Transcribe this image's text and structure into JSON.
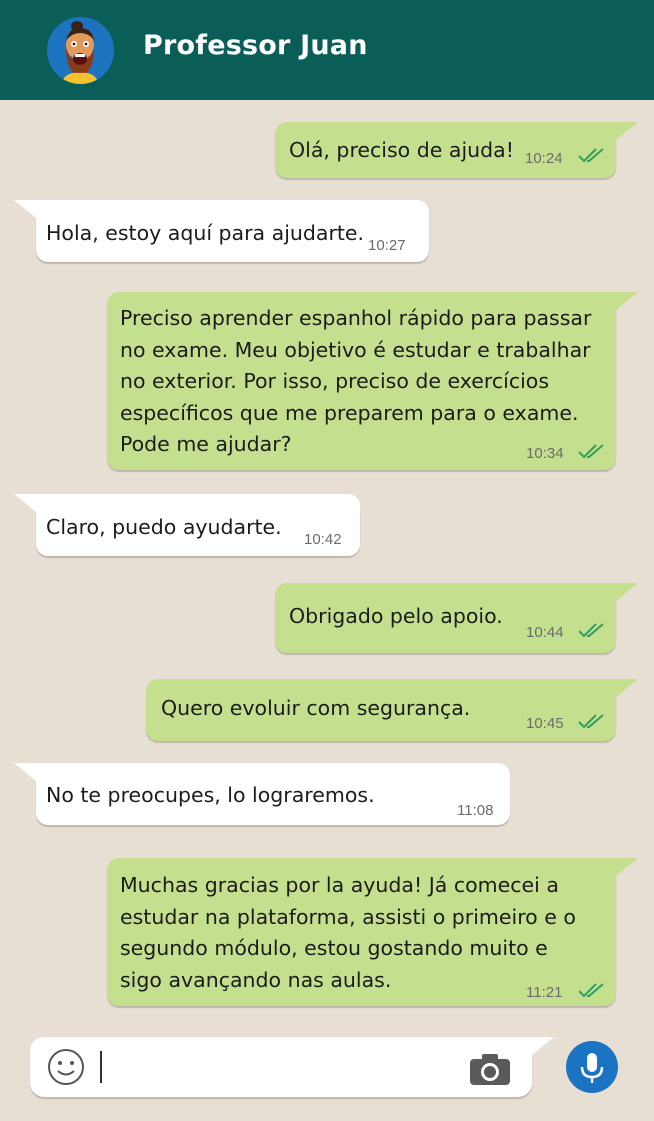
{
  "header": {
    "contact_name": "Professor Juan",
    "avatar_icon": "bearded-cartoon-man-avatar",
    "bar_color": "#0b5e58"
  },
  "colors": {
    "background": "#e8dfd4",
    "outgoing_bubble": "#c4e08f",
    "incoming_bubble": "#ffffff",
    "read_check": "#2f9e5e",
    "mic_button": "#1b73c4"
  },
  "messages": [
    {
      "direction": "out",
      "text": "Olá, preciso de ajuda!",
      "time": "10:24",
      "status": "read"
    },
    {
      "direction": "in",
      "text": "Hola, estoy aquí para ajudarte.",
      "time": "10:27"
    },
    {
      "direction": "out",
      "text": "Preciso aprender espanhol rápido para passar\nno exame. Meu objetivo é estudar e trabalhar\nno exterior. Por isso, preciso de exercícios\nespecíficos que me preparem para o exame.\nPode me ajudar?",
      "time": "10:34",
      "status": "read"
    },
    {
      "direction": "in",
      "text": "Claro, puedo ayudarte.",
      "time": "10:42"
    },
    {
      "direction": "out",
      "text": "Obrigado pelo apoio.",
      "time": "10:44",
      "status": "read"
    },
    {
      "direction": "out",
      "text": "Quero evoluir com segurança.",
      "time": "10:45",
      "status": "read"
    },
    {
      "direction": "in",
      "text": "No te preocupes, lo lograremos.",
      "time": "11:08"
    },
    {
      "direction": "out",
      "text": "Muchas gracias por la ayuda! Já comecei a\nestudar na plataforma, assisti o primeiro e o\nsegundo módulo, estou gostando muito e\nsigo avançando nas aulas.",
      "time": "11:21",
      "status": "read"
    }
  ],
  "composer": {
    "value": "",
    "placeholder": "",
    "emoji_icon": "smiley-face-icon",
    "camera_icon": "camera-icon",
    "mic_icon": "microphone-icon"
  }
}
